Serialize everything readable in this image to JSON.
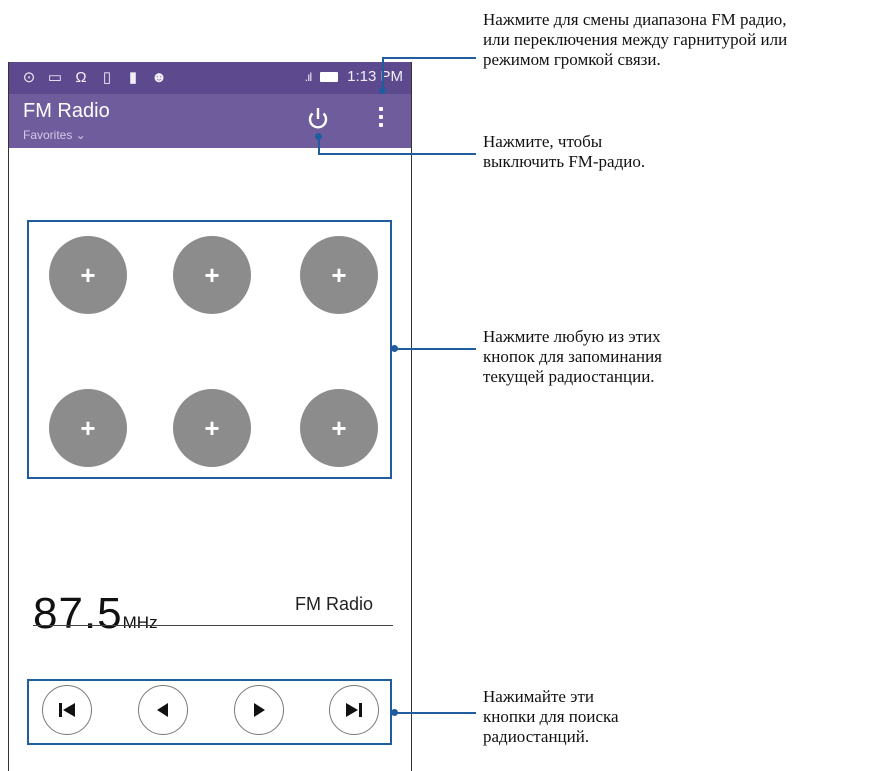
{
  "status_bar": {
    "icons": [
      "clock-icon",
      "message-icon",
      "headset-icon",
      "sim-icon",
      "sd-card-icon",
      "android-icon"
    ],
    "signal": ".ıl",
    "time": "1:13 PM"
  },
  "app_bar": {
    "title": "FM Radio",
    "subtitle": "Favorites ⌄",
    "power_icon": "power-icon",
    "menu_icon": "more-vert-icon"
  },
  "presets": [
    {
      "label": "+"
    },
    {
      "label": "+"
    },
    {
      "label": "+"
    },
    {
      "label": "+"
    },
    {
      "label": "+"
    },
    {
      "label": "+"
    }
  ],
  "tuner": {
    "frequency": "87.5",
    "unit": "MHz",
    "station": "FM Radio"
  },
  "controls": [
    {
      "icon": "skip-previous-icon"
    },
    {
      "icon": "seek-back-icon"
    },
    {
      "icon": "seek-forward-icon"
    },
    {
      "icon": "skip-next-icon"
    }
  ],
  "annotations": {
    "menu": "Нажмите для смены диапазона FM радио,\nили переключения между гарнитурой или\nрежимом громкой связи.",
    "power": "Нажмите, чтобы\nвыключить FM-радио.",
    "presets": "Нажмите любую из этих\nкнопок для запоминания\nтекущей радиостанции.",
    "seek": "Нажимайте эти\nкнопки для поиска\nрадиостанций."
  },
  "colors": {
    "status_bar": "#5d4a8e",
    "app_bar": "#6f5c9c",
    "preset_button": "#8c8c8c",
    "callout": "#1f5d9e"
  }
}
